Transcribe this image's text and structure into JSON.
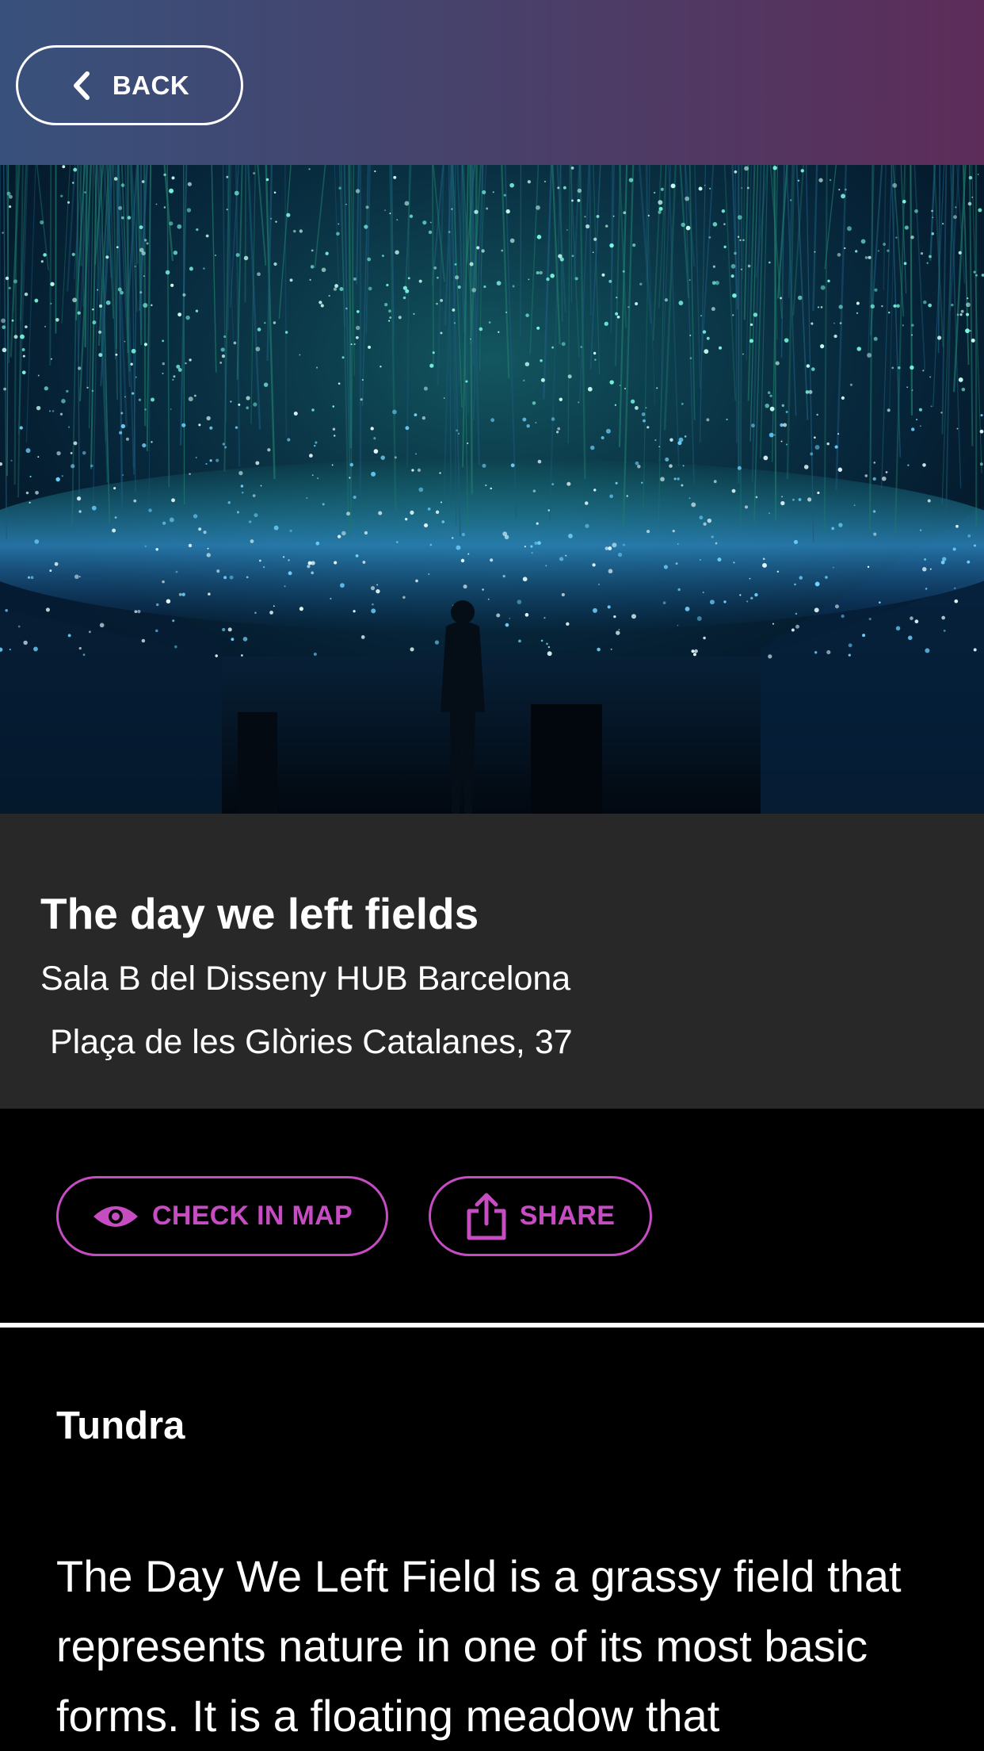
{
  "header": {
    "back_label": "BACK",
    "gradient_colors": [
      "#38517c",
      "#5d2c59"
    ]
  },
  "hero": {
    "icon": "art-installation-photo"
  },
  "event": {
    "title": "The day we left fields",
    "venue": "Sala B del Disseny HUB Barcelona",
    "address": " Plaça de les Glòries Catalanes, 37"
  },
  "actions": {
    "check_in_map_label": "CHECK IN MAP",
    "check_in_map_icon": "eye-icon",
    "share_label": "SHARE",
    "share_icon": "share-icon",
    "accent_color": "#c54cc1"
  },
  "description": {
    "section_title": "Tundra",
    "text": "The Day We Left Field is a grassy field that represents nature in one of its most basic forms. It is a floating meadow that"
  }
}
